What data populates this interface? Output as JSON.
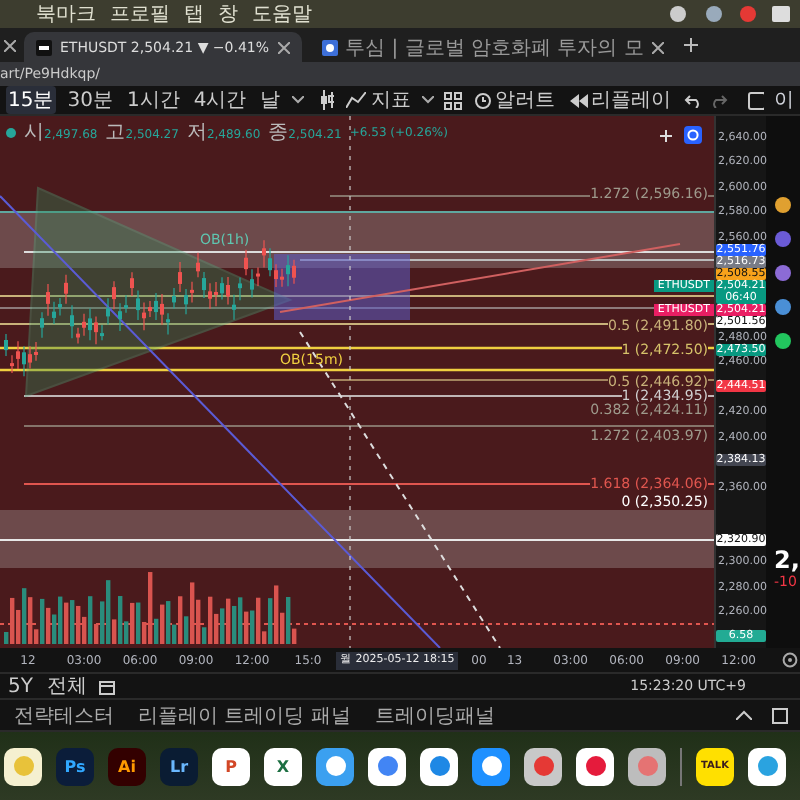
{
  "menu_bar": {
    "items": [
      "북마크",
      "프로필",
      "탭",
      "창",
      "도움말"
    ]
  },
  "browser_tabs": [
    {
      "title": "ETHUSDT 2,504.21 ▼ −0.41%",
      "selected": true,
      "kind": "chart"
    },
    {
      "title": "투심 | 글로벌 암호화폐 투자의 모",
      "selected": false,
      "kind": "page"
    }
  ],
  "address_bar": {
    "url": "art/Pe9Hdkqp/"
  },
  "toolbar": {
    "intervals": [
      {
        "label": "15분",
        "selected": true
      },
      {
        "label": "30분",
        "selected": false
      },
      {
        "label": "1시간",
        "selected": false
      },
      {
        "label": "4시간",
        "selected": false
      },
      {
        "label": "날",
        "selected": false
      }
    ],
    "indicators": "지표",
    "alert": "알러트",
    "replay": "리플레이",
    "layout_label": "이"
  },
  "ohlc": {
    "items": [
      {
        "label": "시",
        "value": "2,497.68"
      },
      {
        "label": "고",
        "value": "2,504.27"
      },
      {
        "label": "저",
        "value": "2,489.60"
      },
      {
        "label": "종",
        "value": "2,504.21"
      }
    ],
    "change": "+6.53 (+0.26%)"
  },
  "zone_labels": [
    "OB(1h)",
    "OB(15m)"
  ],
  "fib_labels": [
    {
      "text": "1.272 (2,596.16)",
      "color": "#9e9a8c"
    },
    {
      "text": "0.5 (2,491.80)",
      "color": "#c9b27a"
    },
    {
      "text": "1 (2,472.50)",
      "color": "#d6c36a"
    },
    {
      "text": "0.5 (2,446.92)",
      "color": "#c9b27a"
    },
    {
      "text": "1 (2,434.95)",
      "color": "#d0d0d0"
    },
    {
      "text": "0.382 (2,424.11)",
      "color": "#9e9a8c"
    },
    {
      "text": "1.272 (2,403.97)",
      "color": "#9e9a8c"
    },
    {
      "text": "1.618 (2,364.06)",
      "color": "#e0564f"
    },
    {
      "text": "0 (2,350.25)",
      "color": "#ffffff"
    }
  ],
  "price_axis": {
    "ticks": [
      "2,640.00",
      "2,620.00",
      "2,600.00",
      "2,580.00",
      "2,560.00",
      "2,480.00",
      "2,460.00",
      "2,420.00",
      "2,400.00",
      "2,360.00",
      "2,300.00",
      "2,280.00",
      "2,260.00"
    ]
  },
  "price_tags": [
    {
      "price": "2,551.76",
      "color": "#2962ff"
    },
    {
      "price": "2,516.73",
      "color": "#787b86"
    },
    {
      "price": "2,508.55",
      "color": "#f7a21b"
    },
    {
      "price": "2,504.21",
      "countdown": "06:40",
      "symbol": "ETHUSDT",
      "color": "#089981"
    },
    {
      "price": "2,504.21",
      "symbol": "ETHUSDT",
      "color": "#e91e63"
    },
    {
      "price": "2,501.56",
      "color": "#ffffff"
    },
    {
      "price": "2,473.50",
      "color": "#089981"
    },
    {
      "price": "2,444.51",
      "color": "#f23645"
    },
    {
      "price": "2,384.13",
      "color": "#434651"
    },
    {
      "price": "2,320.90",
      "color": "#ffffff"
    },
    {
      "price": "6.58",
      "color": "#22ab94",
      "kind": "volume"
    }
  ],
  "time_axis": {
    "before": [
      "12",
      "03:00",
      "06:00",
      "09:00",
      "12:00",
      "15:0"
    ],
    "cursor_date": "월 2025-05-12  18:15",
    "after": [
      "00",
      "13",
      "03:00",
      "06:00",
      "09:00",
      "12:00"
    ]
  },
  "bottom_bar": {
    "ranges": [
      "5Y",
      "전체"
    ],
    "clock": "15:23:20 UTC+9"
  },
  "panel_tabs": [
    "전략테스터",
    "리플레이 트레이딩 패널",
    "트레이딩패널"
  ],
  "right_panel": {
    "price": "2,",
    "change": "-10"
  },
  "dock": [
    {
      "kind": "notes"
    },
    {
      "kind": "ps",
      "label": "Ps"
    },
    {
      "kind": "ai",
      "label": "Ai"
    },
    {
      "kind": "lr",
      "label": "Lr"
    },
    {
      "kind": "ppt",
      "label": "P"
    },
    {
      "kind": "xls",
      "label": "X"
    },
    {
      "kind": "mail"
    },
    {
      "kind": "chrome"
    },
    {
      "kind": "safari"
    },
    {
      "kind": "store"
    },
    {
      "kind": "grid"
    },
    {
      "kind": "music"
    },
    {
      "kind": "phone"
    },
    {
      "kind": "divider"
    },
    {
      "kind": "talk",
      "label": "TALK"
    },
    {
      "kind": "telegram"
    }
  ]
}
